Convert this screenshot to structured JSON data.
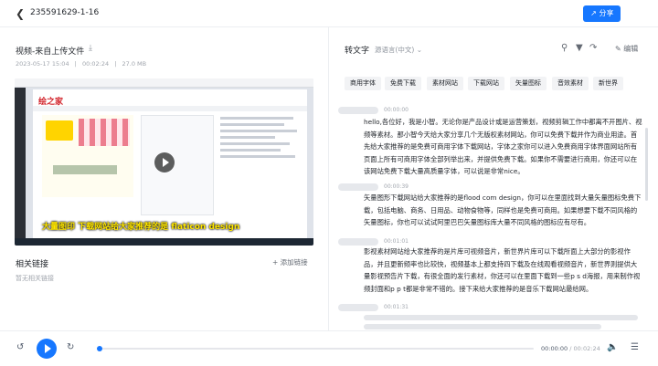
{
  "header": {
    "title": "235591629-1-16",
    "share_label": "分享"
  },
  "media": {
    "title": "视频-来自上传文件",
    "date": "2023-05-17 15:04",
    "duration": "00:02:24",
    "size": "27.0 MB",
    "video_logo_text": "绘之家",
    "video_caption": "大量图印 下载网站给大家推荐的是 flaticon design"
  },
  "related": {
    "title": "相关链接",
    "add_label": "添加链接",
    "empty_text": "暂无相关链接"
  },
  "transcript": {
    "tab_label": "转文字",
    "language": "源语言(中文)",
    "edit_label": "编辑",
    "keywords": [
      "商用字体",
      "免费下载",
      "素材网站",
      "下载网站",
      "矢量图标",
      "音效素材",
      "新世界"
    ],
    "segments": [
      {
        "time": "00:00:00",
        "text": "hello,各位好，我是小智。无论你是产品设计或是运营策划，视频剪辑工作中都离不开图片、视频等素材。那小智今天给大家分享几个无版权素材网站，你可以免费下载并作为商业用途。首先给大家推荐的是免费可商用字体下载网站，字体之家你可以进入免费商用字体界面网站所有页面上所有可商用字体全部列举出来，并提供免费下载。如果你不需要进行商用，你还可以在该网站免费下载大量高质量字体，可以说是非常nice。"
      },
      {
        "time": "00:00:39",
        "text": "矢量图形下载网站给大家推荐的是flood com design，你可以在里面找到大量矢量图标免费下载，包括电脑、商务、日用品、动物食物等，同样也是免费可商用。如果想要下载不同风格的矢量图标，你也可以试试阿里巴巴矢量图标库大量不同风格的图标应有尽有。"
      },
      {
        "time": "00:01:01",
        "text": "影视素材网站给大家推荐的是片库可视频音片，新世界片库可以下载所面上大部分的影视作品，并且更新频率也比较快，视频基本上都支持四下载及在线观看视频音片，新世界则提供大量影视预告片下载，有很全面的发行素材，你还可以在里面下载到一些p s d海报，用来制作视频封面和p p t都是非常不错的。接下来给大家推荐的是音乐下载网站最给网。"
      },
      {
        "time": "00:01:31",
        "text": ""
      }
    ]
  },
  "player": {
    "current": "00:00:00",
    "total": "00:02:24",
    "progress": 0.0
  }
}
